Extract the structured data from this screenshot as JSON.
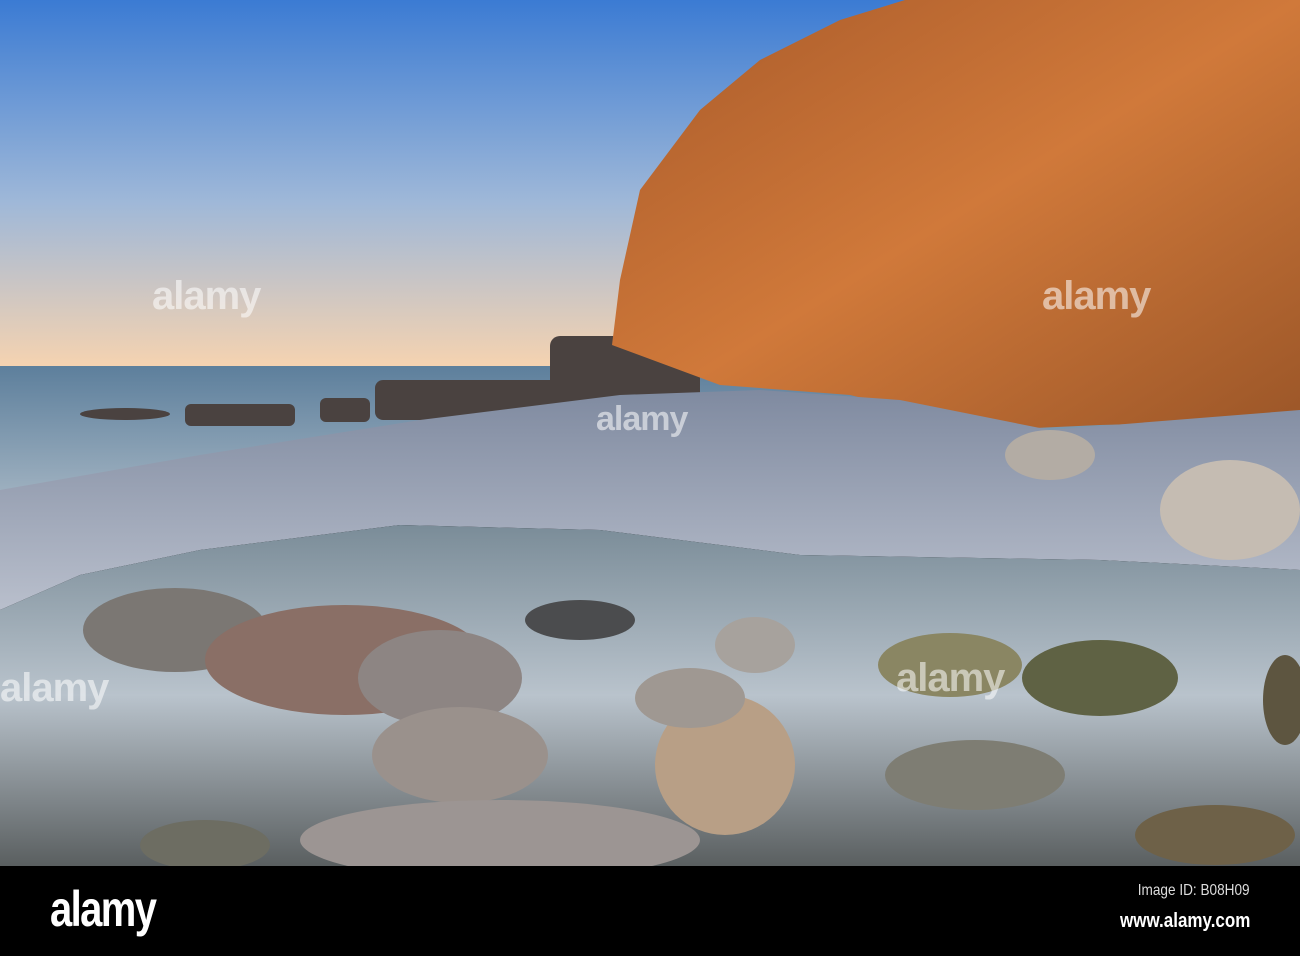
{
  "photo": {
    "subject": "rocky cove with cliff at sunset",
    "colors": {
      "sky_top": "#3b7bd3",
      "sky_horizon": "#f6d3b0",
      "sea": "#6a8ca8",
      "cliff": "#c76a2c",
      "pebbles": "#8d96a8",
      "water": "#7d8e99"
    }
  },
  "watermark": {
    "text": "alamy"
  },
  "footer": {
    "logo": "alamy",
    "image_id": "Image ID: B08H09",
    "url": "www.alamy.com"
  }
}
